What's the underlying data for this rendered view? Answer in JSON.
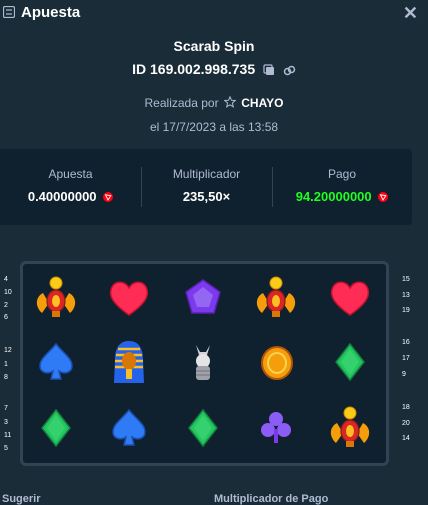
{
  "header": {
    "title": "Apuesta",
    "close_icon": "close-icon",
    "bet_icon": "bet-slip-icon"
  },
  "game": {
    "name": "Scarab Spin"
  },
  "bet": {
    "id": "ID 169.002.998.735",
    "placed_by_label": "Realizada por",
    "user": "CHAYO",
    "date": "el 17/7/2023 a las 13:58"
  },
  "stats": {
    "bet_label": "Apuesta",
    "bet_value": "0.40000000",
    "multiplier_label": "Multiplicador",
    "multiplier_value": "235,50×",
    "payout_label": "Pago",
    "payout_value": "94.20000000",
    "currency_icon": "tron-coin-icon",
    "payout_color": "#1fff20"
  },
  "reels": [
    [
      "scarab",
      "heart",
      "pentagon-gem",
      "scarab",
      "heart"
    ],
    [
      "spade",
      "pharaoh",
      "anubis",
      "coin",
      "diamond"
    ],
    [
      "diamond",
      "spade",
      "diamond",
      "club",
      "scarab"
    ]
  ],
  "paylines": {
    "left": [
      [
        "4",
        "10",
        "2",
        "6"
      ],
      [
        "12",
        "1",
        "8"
      ],
      [
        "7",
        "3",
        "11",
        "5"
      ]
    ],
    "right": [
      [
        "15",
        "13",
        "19"
      ],
      [
        "16",
        "17",
        "9"
      ],
      [
        "18",
        "20",
        "14"
      ]
    ]
  },
  "footer": {
    "left": "Sugerir",
    "right": "Multiplicador de Pago"
  }
}
